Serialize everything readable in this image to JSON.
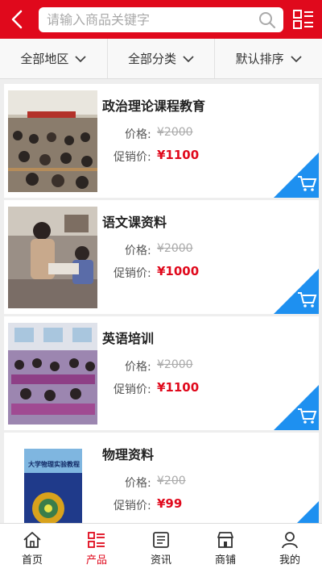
{
  "theme": {
    "accent": "#e0091c",
    "cart_accent": "#1e90f0"
  },
  "header": {
    "back_icon": "chevron-left-icon",
    "search_placeholder": "请输入商品关键字",
    "search_icon": "search-icon",
    "menu_icon": "list-menu-icon"
  },
  "filters": [
    {
      "label": "全部地区",
      "icon": "chevron-down-icon"
    },
    {
      "label": "全部分类",
      "icon": "chevron-down-icon"
    },
    {
      "label": "默认排序",
      "icon": "chevron-down-icon"
    }
  ],
  "products": [
    {
      "title": "政治理论课程教育",
      "price_label": "价格:",
      "price": "¥2000",
      "promo_label": "促销价:",
      "promo_price": "¥1100",
      "cart_icon": "cart-icon"
    },
    {
      "title": "语文课资料",
      "price_label": "价格:",
      "price": "¥2000",
      "promo_label": "促销价:",
      "promo_price": "¥1000",
      "cart_icon": "cart-icon"
    },
    {
      "title": "英语培训",
      "price_label": "价格:",
      "price": "¥2000",
      "promo_label": "促销价:",
      "promo_price": "¥1100",
      "cart_icon": "cart-icon"
    },
    {
      "title": "物理资料",
      "price_label": "价格:",
      "price": "¥200",
      "promo_label": "促销价:",
      "promo_price": "¥99",
      "cart_icon": "cart-icon",
      "cover_text": "大学物理实验教程"
    }
  ],
  "nav": [
    {
      "label": "首页",
      "icon": "home-icon",
      "active": false
    },
    {
      "label": "产品",
      "icon": "product-list-icon",
      "active": true
    },
    {
      "label": "资讯",
      "icon": "news-icon",
      "active": false
    },
    {
      "label": "商铺",
      "icon": "store-icon",
      "active": false
    },
    {
      "label": "我的",
      "icon": "user-icon",
      "active": false
    }
  ]
}
